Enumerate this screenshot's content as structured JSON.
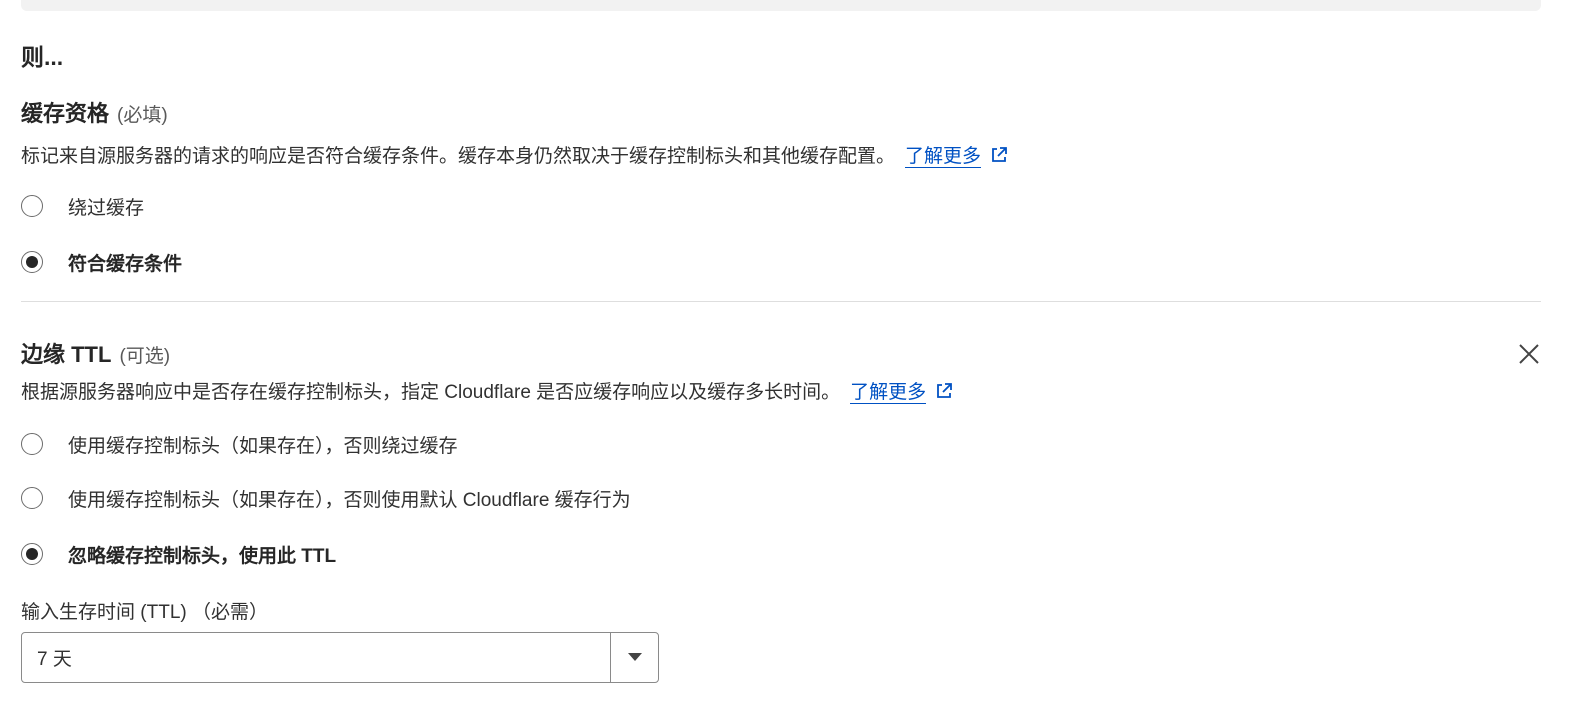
{
  "then_heading": "则...",
  "cache_eligibility": {
    "title": "缓存资格",
    "qualifier": "(必填)",
    "description": "标记来自源服务器的请求的响应是否符合缓存条件。缓存本身仍然取决于缓存控制标头和其他缓存配置。",
    "learn_more": "了解更多",
    "options": [
      {
        "label": "绕过缓存",
        "selected": false
      },
      {
        "label": "符合缓存条件",
        "selected": true
      }
    ]
  },
  "edge_ttl": {
    "title": "边缘 TTL",
    "qualifier": "(可选)",
    "description": "根据源服务器响应中是否存在缓存控制标头，指定 Cloudflare 是否应缓存响应以及缓存多长时间。",
    "learn_more": "了解更多",
    "options": [
      {
        "label": "使用缓存控制标头（如果存在），否则绕过缓存",
        "selected": false
      },
      {
        "label": "使用缓存控制标头（如果存在），否则使用默认 Cloudflare 缓存行为",
        "selected": false
      },
      {
        "label": "忽略缓存控制标头，使用此 TTL",
        "selected": true
      }
    ],
    "ttl_label": "输入生存时间 (TTL) （必需）",
    "ttl_value": "7 天"
  },
  "icons": {
    "external_link": "external-link-icon",
    "close": "close-icon",
    "dropdown": "caret-down-icon"
  },
  "colors": {
    "link": "#0051c3",
    "text": "#313131",
    "heading": "#262626",
    "divider": "#dedede"
  }
}
